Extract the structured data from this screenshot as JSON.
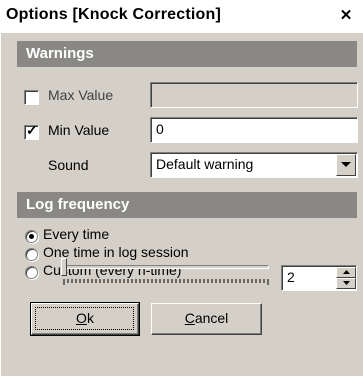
{
  "window": {
    "title": "Options [Knock Correction]",
    "close_icon": "close-icon"
  },
  "warnings": {
    "header": "Warnings",
    "max_value": {
      "label": "Max Value",
      "checked": false,
      "value": ""
    },
    "min_value": {
      "label": "Min Value",
      "checked": true,
      "value": "0"
    },
    "sound": {
      "label": "Sound",
      "selected": "Default warning"
    }
  },
  "log_frequency": {
    "header": "Log frequency",
    "options": [
      {
        "label": "Every time",
        "selected": true
      },
      {
        "label": "One time in log session",
        "selected": false
      },
      {
        "label": "Custom (every n-time)",
        "selected": false
      }
    ],
    "custom_n": "2"
  },
  "buttons": {
    "ok_mnemonic": "O",
    "ok_rest": "k",
    "cancel_mnemonic": "C",
    "cancel_rest": "ancel"
  }
}
